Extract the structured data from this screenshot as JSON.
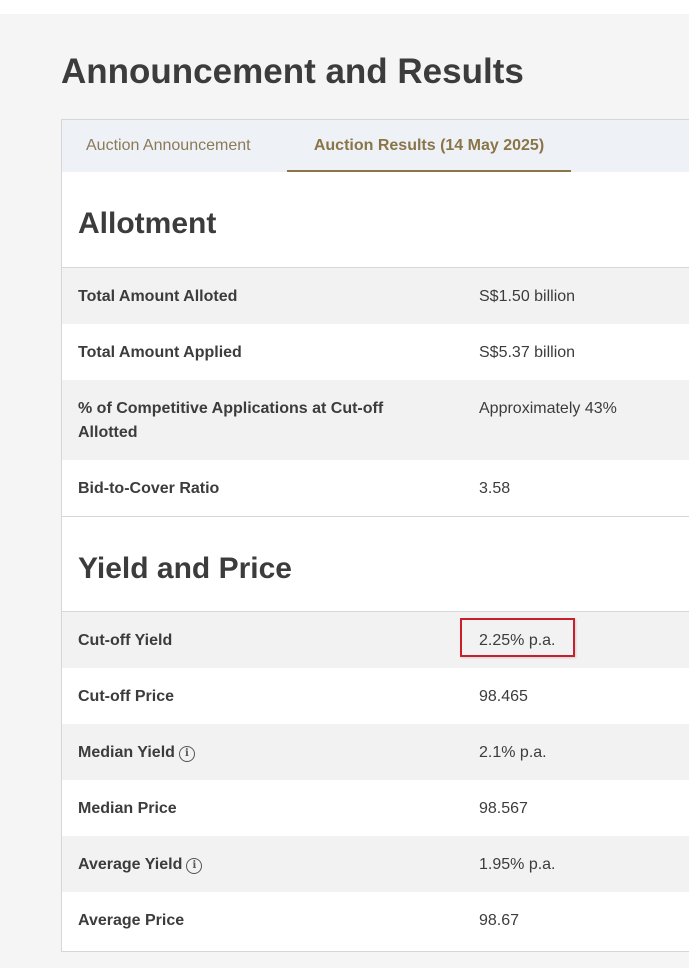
{
  "page": {
    "title": "Announcement and Results"
  },
  "tabs": [
    {
      "label": "Auction Announcement",
      "active": false
    },
    {
      "label": "Auction Results (14 May 2025)",
      "active": true
    }
  ],
  "allotment": {
    "heading": "Allotment",
    "rows": [
      {
        "label": "Total Amount Alloted",
        "value": "S$1.50 billion"
      },
      {
        "label": "Total Amount Applied",
        "value": "S$5.37 billion"
      },
      {
        "label": "% of Competitive Applications at Cut-off Allotted",
        "value": "Approximately 43%"
      },
      {
        "label": "Bid-to-Cover Ratio",
        "value": "3.58"
      }
    ]
  },
  "yield_price": {
    "heading": "Yield and Price",
    "rows": [
      {
        "label": "Cut-off Yield",
        "value": "2.25% p.a."
      },
      {
        "label": "Cut-off Price",
        "value": "98.465"
      },
      {
        "label": "Median Yield",
        "value": "2.1% p.a.",
        "info_icon": "info-icon"
      },
      {
        "label": "Median Price",
        "value": "98.567"
      },
      {
        "label": "Average Yield",
        "value": "1.95% p.a.",
        "info_icon": "info-icon"
      },
      {
        "label": "Average Price",
        "value": "98.67"
      }
    ]
  },
  "info_icon_glyph": "i",
  "colors": {
    "accent": "#8a7548",
    "highlight": "#c8202a",
    "row_alt": "#f2f2f2",
    "tab_bar": "#eef2f6"
  }
}
